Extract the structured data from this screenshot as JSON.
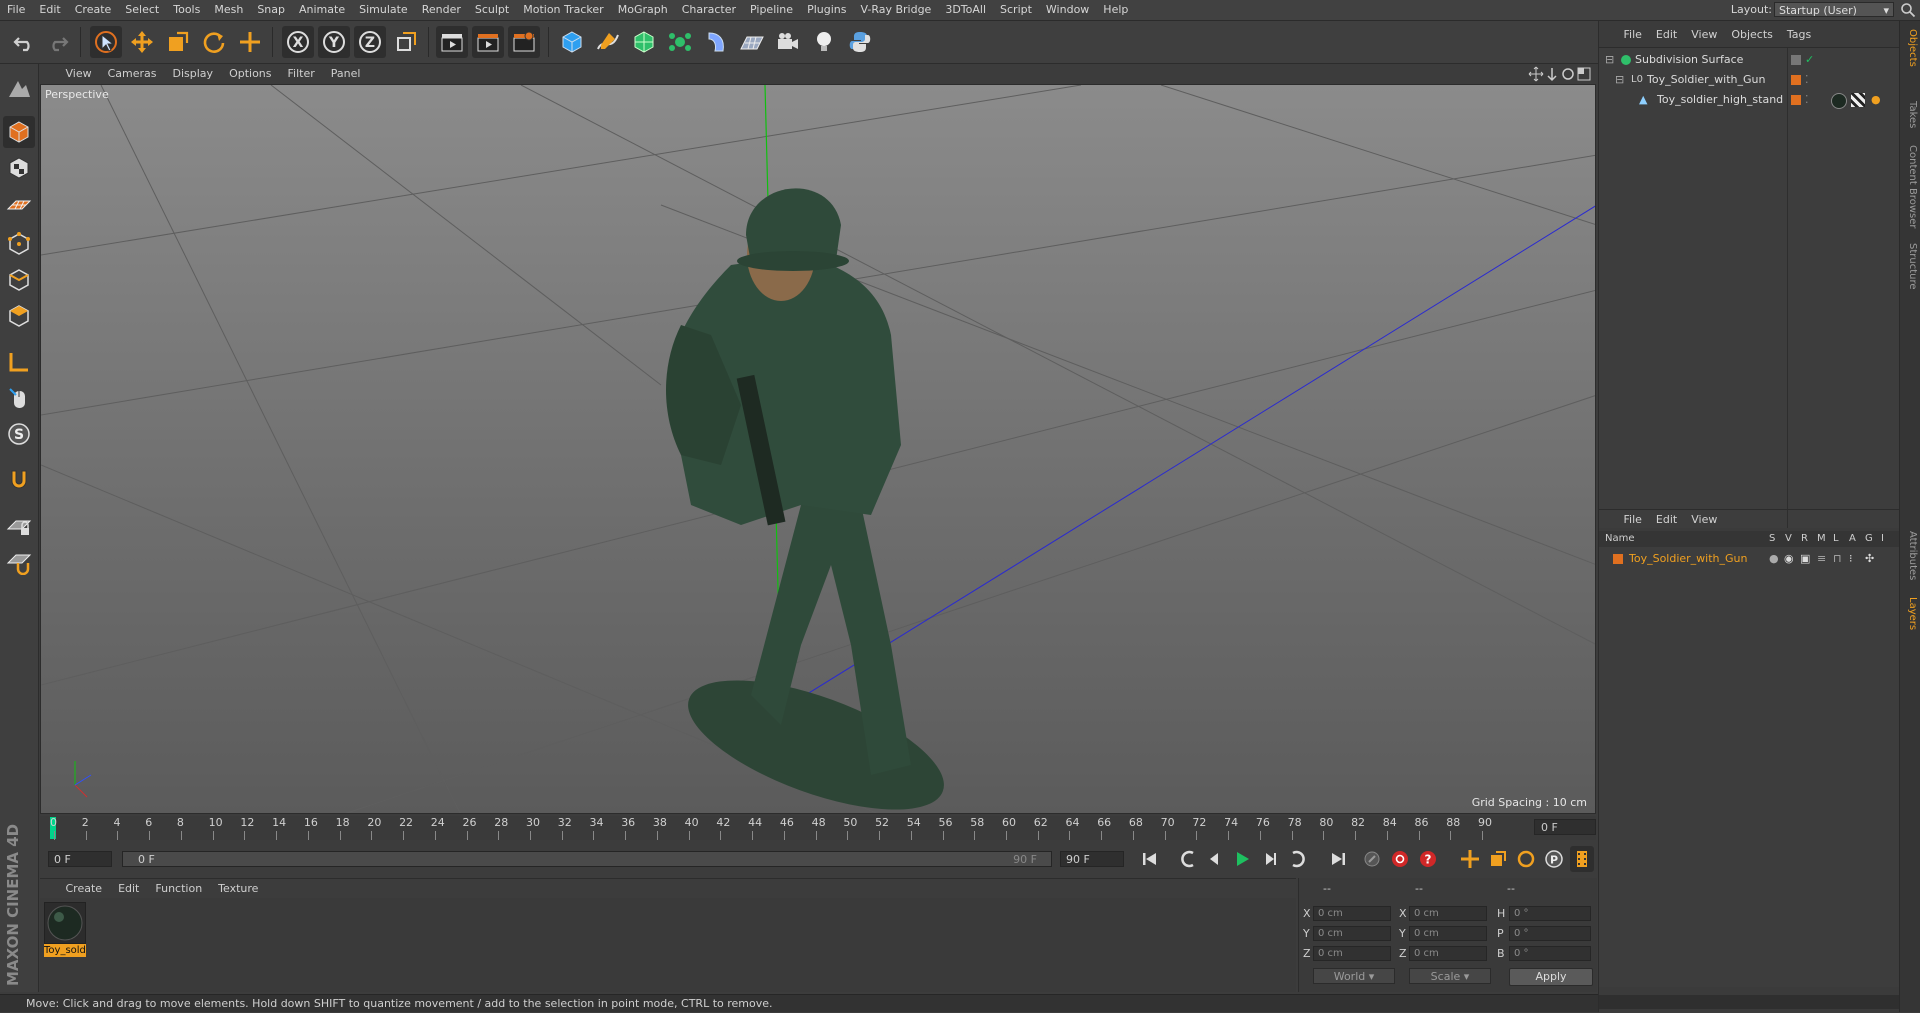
{
  "menubar": {
    "items": [
      "File",
      "Edit",
      "Create",
      "Select",
      "Tools",
      "Mesh",
      "Snap",
      "Animate",
      "Simulate",
      "Render",
      "Sculpt",
      "Motion Tracker",
      "MoGraph",
      "Character",
      "Pipeline",
      "Plugins",
      "V-Ray Bridge",
      "3DToAll",
      "Script",
      "Window",
      "Help"
    ],
    "layout_label": "Layout:",
    "layout_value": "Startup (User)"
  },
  "toolbar": {
    "undo": "undo-icon",
    "redo": "redo-icon",
    "axis_x": "X",
    "axis_y": "Y",
    "axis_z": "Z"
  },
  "viewport": {
    "menu": [
      "View",
      "Cameras",
      "Display",
      "Options",
      "Filter",
      "Panel"
    ],
    "label": "Perspective",
    "grid_spacing": "Grid Spacing : 10 cm"
  },
  "timeline": {
    "ticks": [
      "0",
      "2",
      "4",
      "6",
      "8",
      "10",
      "12",
      "14",
      "16",
      "18",
      "20",
      "22",
      "24",
      "26",
      "28",
      "30",
      "32",
      "34",
      "36",
      "38",
      "40",
      "42",
      "44",
      "46",
      "48",
      "50",
      "52",
      "54",
      "56",
      "58",
      "60",
      "62",
      "64",
      "66",
      "68",
      "70",
      "72",
      "74",
      "76",
      "78",
      "80",
      "82",
      "84",
      "86",
      "88",
      "90"
    ],
    "current_frame": "0 F"
  },
  "transport": {
    "start_field": "0 F",
    "range_start": "0 F",
    "range_end": "90 F",
    "end_field": "90 F"
  },
  "material_manager": {
    "menu": [
      "Create",
      "Edit",
      "Function",
      "Texture"
    ],
    "material_label": "Toy_soldi"
  },
  "coordinates": {
    "header_1": "--",
    "header_2": "--",
    "header_3": "--",
    "rows": [
      {
        "label": "X",
        "pos": "0 cm",
        "size_label": "X",
        "size": "0 cm",
        "rot_label": "H",
        "rot": "0 °"
      },
      {
        "label": "Y",
        "pos": "0 cm",
        "size_label": "Y",
        "size": "0 cm",
        "rot_label": "P",
        "rot": "0 °"
      },
      {
        "label": "Z",
        "pos": "0 cm",
        "size_label": "Z",
        "size": "0 cm",
        "rot_label": "B",
        "rot": "0 °"
      }
    ],
    "world": "World",
    "scale": "Scale",
    "apply": "Apply"
  },
  "objects": {
    "menu": [
      "File",
      "Edit",
      "View",
      "Objects",
      "Tags"
    ],
    "items": [
      {
        "name": "Subdivision Surface",
        "color": "#8fd0ff"
      },
      {
        "name": "Toy_Soldier_with_Gun",
        "color": "#e07020"
      },
      {
        "name": "Toy_soldier_high_stand",
        "color": "#e07020"
      }
    ]
  },
  "layers": {
    "menu": [
      "File",
      "Edit",
      "View"
    ],
    "header_name": "Name",
    "columns": [
      "S",
      "V",
      "R",
      "M",
      "L",
      "A",
      "G",
      "I"
    ],
    "items": [
      {
        "name": "Toy_Soldier_with_Gun",
        "color": "#e07020"
      }
    ]
  },
  "side_tabs": [
    "Objects",
    "Takes",
    "Content Browser",
    "Structure",
    "Attributes",
    "Layers"
  ],
  "status": "Move: Click and drag to move elements. Hold down SHIFT to quantize movement / add to the selection in point mode, CTRL to remove.",
  "brand": "MAXON CINEMA 4D",
  "colors": {
    "accent": "#f0a020",
    "playhead": "#00d38a",
    "soldier": "#2f4a3a"
  }
}
